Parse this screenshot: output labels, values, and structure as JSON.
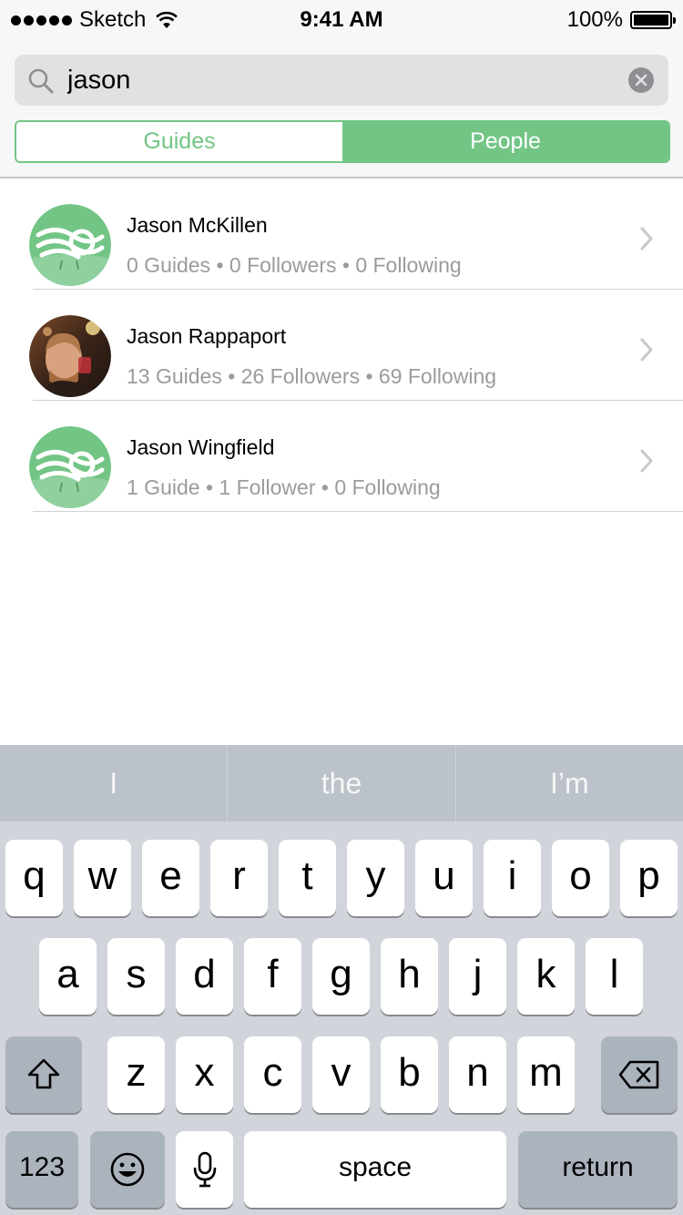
{
  "status_bar": {
    "carrier": "Sketch",
    "time": "9:41 AM",
    "battery": "100%"
  },
  "search": {
    "value": "jason"
  },
  "segments": {
    "guides": "Guides",
    "people": "People",
    "selected": "People"
  },
  "results": [
    {
      "name": "Jason McKillen",
      "stats": "0 Guides • 0 Followers • 0 Following",
      "avatar": "knot-logo-avatar"
    },
    {
      "name": "Jason Rappaport",
      "stats": "13 Guides • 26 Followers • 69 Following",
      "avatar": "photo-avatar"
    },
    {
      "name": "Jason Wingfield",
      "stats": "1 Guide • 1 Follower • 0 Following",
      "avatar": "knot-logo-avatar"
    }
  ],
  "keyboard": {
    "predictions": [
      "I",
      "the",
      "I’m"
    ],
    "row1": [
      "q",
      "w",
      "e",
      "r",
      "t",
      "y",
      "u",
      "i",
      "o",
      "p"
    ],
    "row2": [
      "a",
      "s",
      "d",
      "f",
      "g",
      "h",
      "j",
      "k",
      "l"
    ],
    "row3": [
      "z",
      "x",
      "c",
      "v",
      "b",
      "n",
      "m"
    ],
    "numbers_key": "123",
    "space_key": "space",
    "return_key": "return"
  },
  "colors": {
    "accent_green": "#73c586",
    "secondary_text": "#9b9b9b"
  }
}
